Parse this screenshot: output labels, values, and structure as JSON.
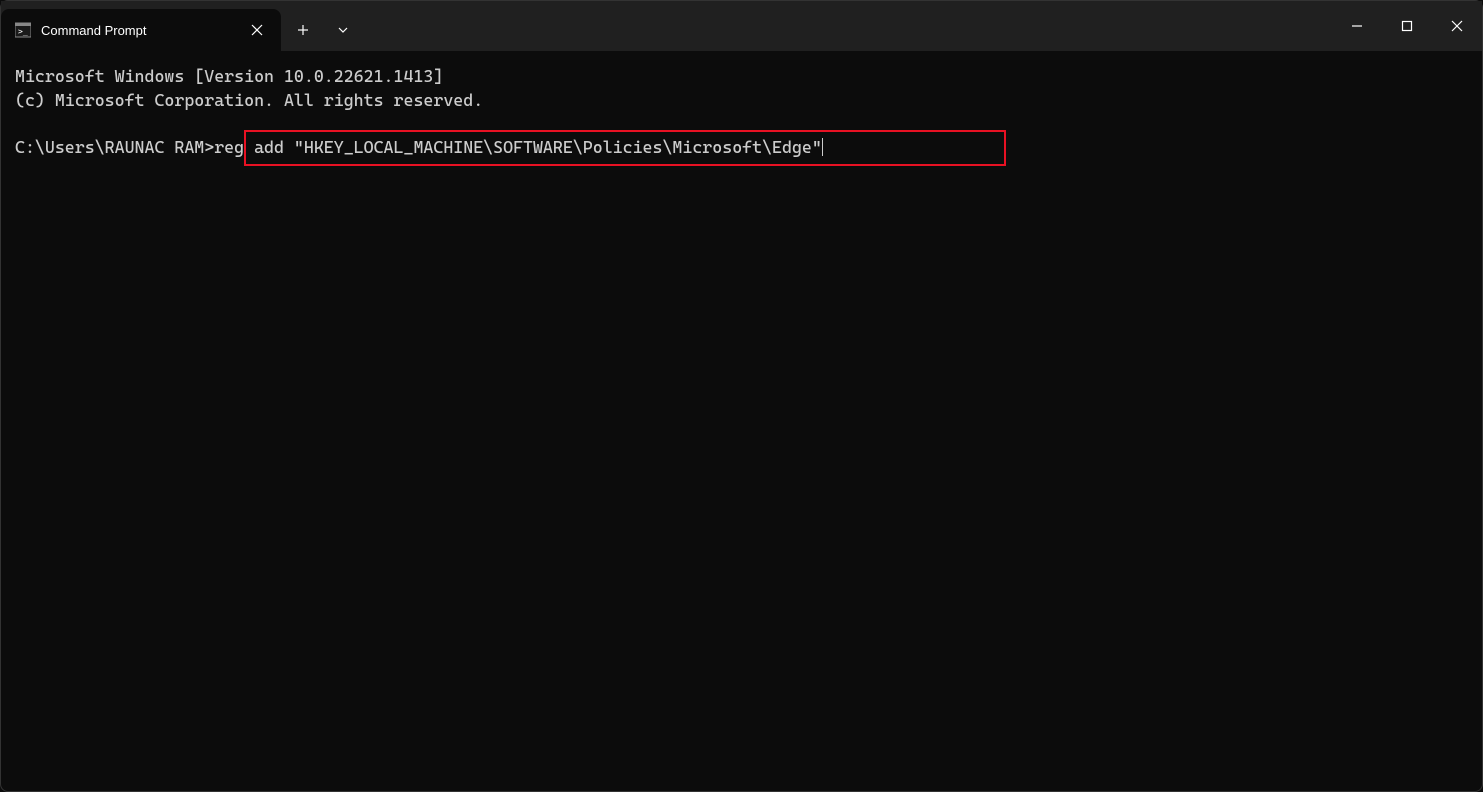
{
  "titlebar": {
    "tab_title": "Command Prompt"
  },
  "terminal": {
    "line1": "Microsoft Windows [Version 10.0.22621.1413]",
    "line2": "(c) Microsoft Corporation. All rights reserved.",
    "blank": "",
    "prompt": "C:\\Users\\RAUNAC RAM>",
    "command": "reg add \"HKEY_LOCAL_MACHINE\\SOFTWARE\\Policies\\Microsoft\\Edge\""
  }
}
